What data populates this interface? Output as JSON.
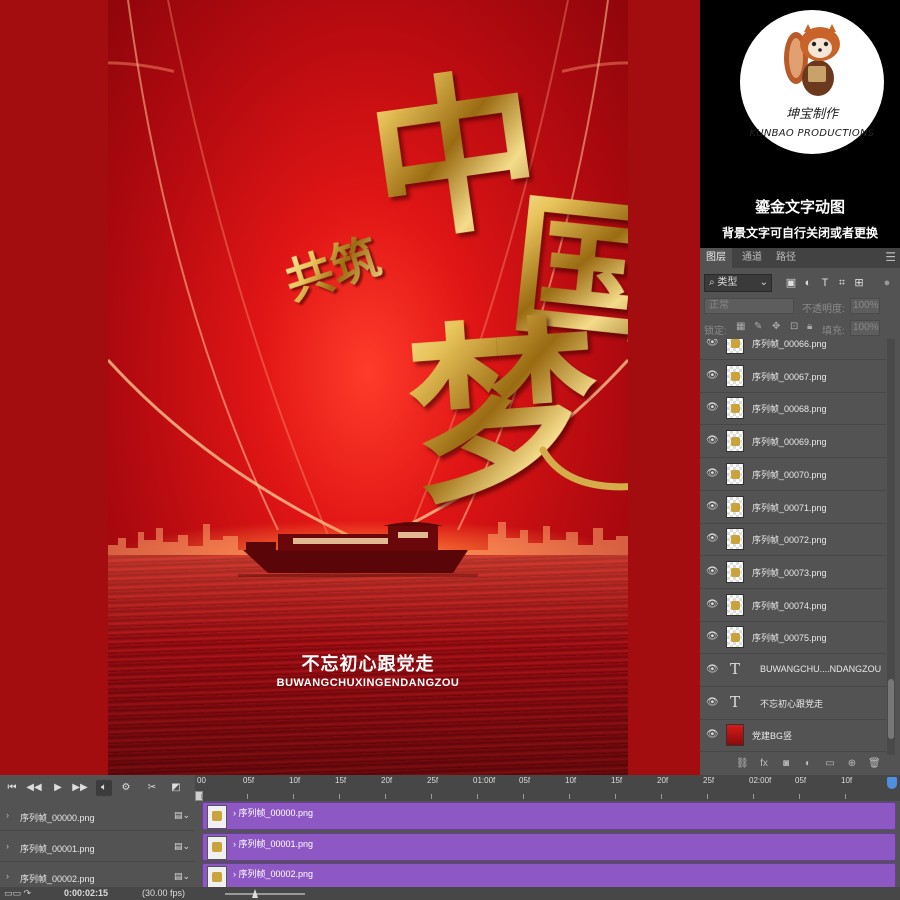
{
  "poster": {
    "title_chars": [
      "中",
      "国",
      "梦"
    ],
    "small_title": "共筑",
    "slogan_cn": "不忘初心跟党走",
    "slogan_en": "BUWANGCHUXINGENDANGZOU"
  },
  "promo": {
    "logo_cn": "坤宝制作",
    "logo_en": "KUNBAO PRODUCTIONS",
    "title": "鎏金文字动图",
    "subtitle": "背景文字可自行关闭或者更换"
  },
  "layers_panel": {
    "tabs": [
      "图层",
      "通道",
      "路径"
    ],
    "menu_icon": "☰",
    "filter_label": "类型",
    "blend_mode": "正常",
    "opacity_label": "不透明度:",
    "opacity_value": "100%",
    "lock_label": "锁定:",
    "fill_label": "填充:",
    "fill_value": "100%",
    "layers": [
      {
        "name": "序列帧_00066.png",
        "type": "image"
      },
      {
        "name": "序列帧_00067.png",
        "type": "image"
      },
      {
        "name": "序列帧_00068.png",
        "type": "image"
      },
      {
        "name": "序列帧_00069.png",
        "type": "image"
      },
      {
        "name": "序列帧_00070.png",
        "type": "image"
      },
      {
        "name": "序列帧_00071.png",
        "type": "image"
      },
      {
        "name": "序列帧_00072.png",
        "type": "image"
      },
      {
        "name": "序列帧_00073.png",
        "type": "image"
      },
      {
        "name": "序列帧_00074.png",
        "type": "image"
      },
      {
        "name": "序列帧_00075.png",
        "type": "image"
      },
      {
        "name": "BUWANGCHU....NDANGZOU",
        "type": "text"
      },
      {
        "name": "不忘初心跟党走",
        "type": "text"
      },
      {
        "name": "党建BG竖",
        "type": "background"
      }
    ],
    "text_layer_icon": "T"
  },
  "timeline": {
    "ruler_labels": [
      "00",
      "05f",
      "10f",
      "15f",
      "20f",
      "25f",
      "01:00f",
      "05f",
      "10f",
      "15f",
      "20f",
      "25f",
      "02:00f",
      "05f",
      "10f"
    ],
    "tracks": [
      {
        "name": "序列帧_00000.png"
      },
      {
        "name": "序列帧_00001.png"
      },
      {
        "name": "序列帧_00002.png"
      }
    ],
    "current_time": "0:00:02:15",
    "fps": "(30.00 fps)"
  },
  "colors": {
    "poster_red": "#e01515",
    "gold": "#c9a33c",
    "timeline_bar": "#8e58c4",
    "panel_bg": "#535353"
  }
}
